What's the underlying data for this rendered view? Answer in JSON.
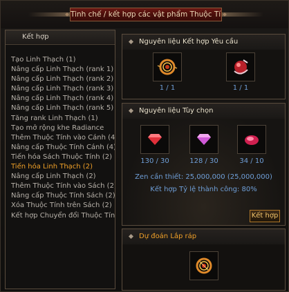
{
  "window": {
    "title": "Tinh chế / kết hợp các vật phẩm Thuộc Tính"
  },
  "left_panel": {
    "header": "Kết hợp",
    "items": [
      "Tạo Linh Thạch (1)",
      "Nâng cấp Linh Thạch (rank 1)",
      "Nâng cấp Linh Thạch (rank 2)",
      "Nâng cấp Linh Thạch (rank 3)",
      "Nâng cấp Linh Thạch (rank 4)",
      "Nâng cấp Linh Thạch (rank 5)",
      "Tăng rank Linh Thạch (1)",
      "Tạo mở rộng khe Radiance",
      "Thêm Thuộc Tính vào Cánh (4",
      "Nâng cấp Thuộc Tính Cánh (4)",
      "Tiến hóa Sách Thuộc Tính (2)",
      "Tiến hóa Linh Thạch (2)",
      "Nâng cấp Linh Thạch (2)",
      "Thêm Thuộc Tính vào Sách (2)",
      "Nâng cấp Thuộc Tính Sách (2)",
      "Xóa Thuộc Tính trên Sách (2)",
      "Kết hợp Chuyển đổi Thuộc Tín"
    ],
    "selected_index": 11
  },
  "required": {
    "header": "Nguyên liệu Kết hợp Yêu cầu",
    "slots": [
      {
        "icon": "gold-ring-icon",
        "count": "1 / 1"
      },
      {
        "icon": "red-orb-icon",
        "count": "1 / 1"
      }
    ]
  },
  "optional": {
    "header": "Nguyên liệu Tùy chọn",
    "slots": [
      {
        "icon": "red-gem-icon",
        "count": "130 / 30"
      },
      {
        "icon": "pink-gem-icon",
        "count": "128 / 30"
      },
      {
        "icon": "crimson-gem-icon",
        "count": "34 / 10"
      }
    ],
    "zen_text": "Zen cần thiết: 25,000,000 (25,000,000)",
    "rate_text": "Kết hợp Tỷ lệ thành công: 80%",
    "combine_button": "Kết hợp"
  },
  "result": {
    "header": "Dự đoán Lắp ráp",
    "icon": "result-ring-icon"
  },
  "colors": {
    "accent_orange": "#f0a028",
    "count_blue": "#6f9fd8",
    "title_red": "#5a120e"
  }
}
